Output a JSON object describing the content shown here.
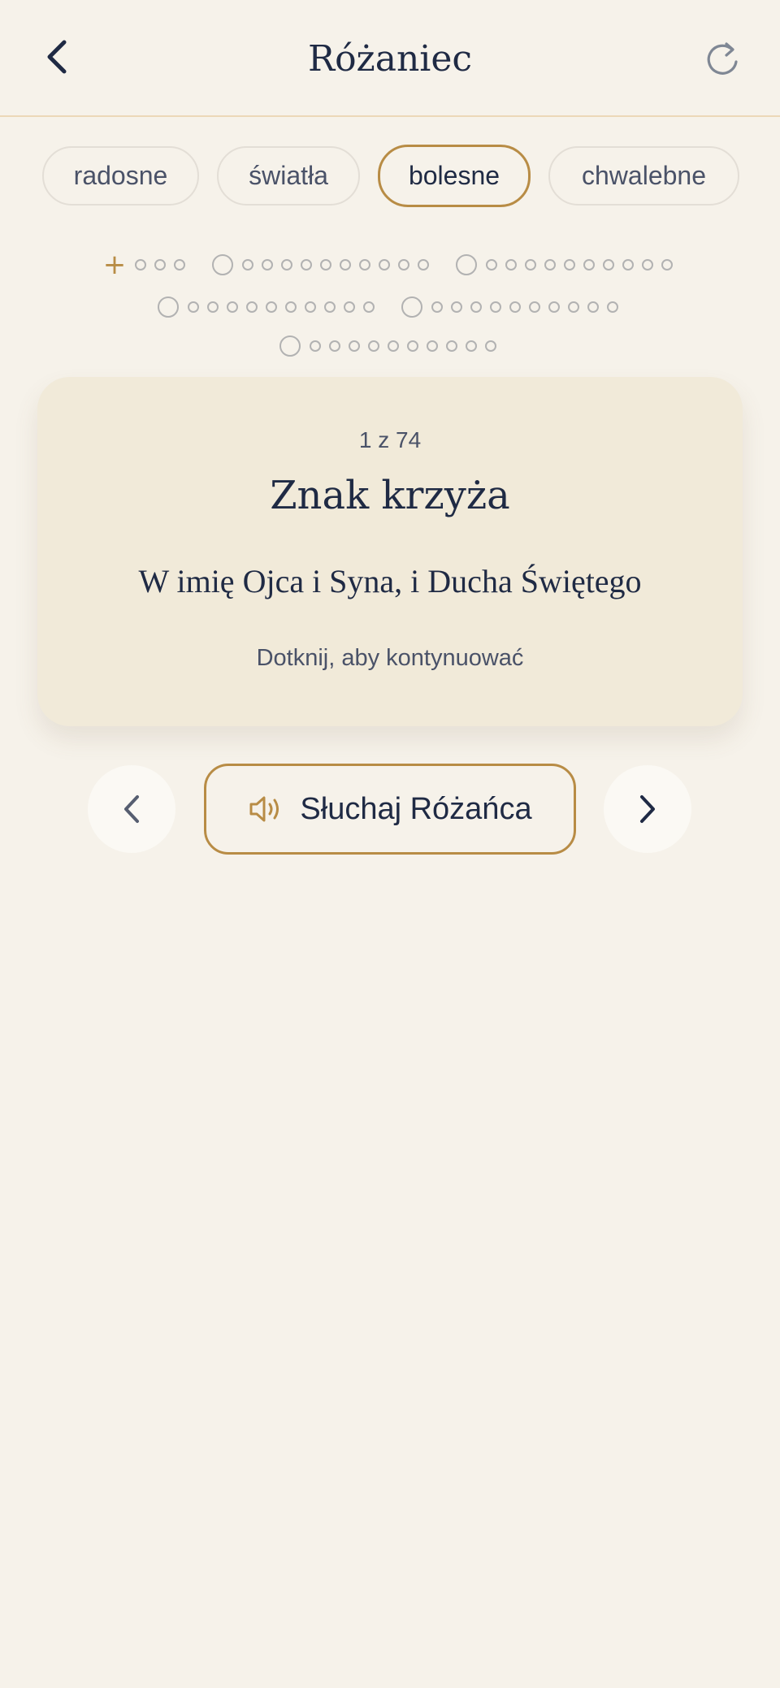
{
  "header": {
    "title": "Różaniec",
    "back_icon": "chevron-left-icon",
    "reset_icon": "refresh-icon"
  },
  "tabs": [
    {
      "label": "radosne",
      "active": false
    },
    {
      "label": "światła",
      "active": false
    },
    {
      "label": "bolesne",
      "active": true
    },
    {
      "label": "chwalebne",
      "active": false
    }
  ],
  "card": {
    "counter": "1 z 74",
    "prayer_name": "Znak krzyża",
    "prayer_text": "W imię Ojca i Syna, i Ducha Świętego",
    "hint": "Dotknij, aby kontynuować"
  },
  "controls": {
    "listen_label": "Słuchaj Różańca",
    "prev_icon": "chevron-left-icon",
    "next_icon": "chevron-right-icon",
    "speaker_icon": "speaker-icon"
  },
  "colors": {
    "background": "#f6f2ea",
    "accent": "#b88c45",
    "text_dark": "#1f2a44",
    "card": "#f1ead9"
  }
}
